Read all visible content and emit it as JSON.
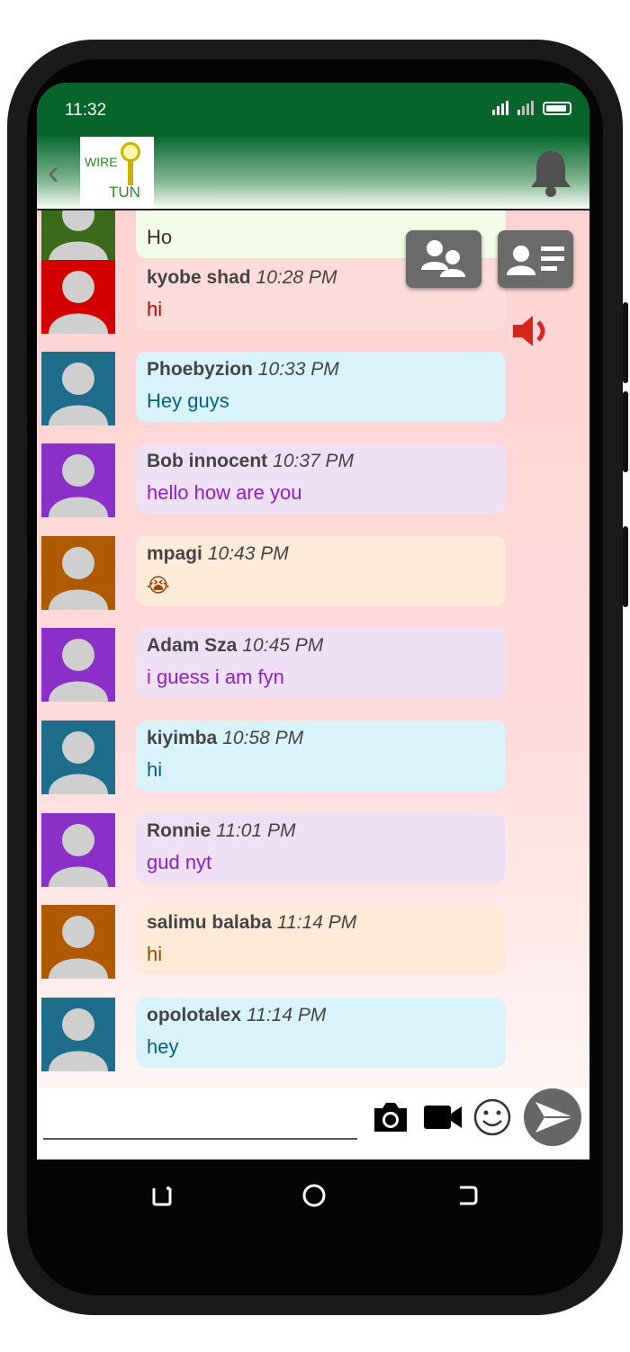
{
  "status": {
    "time": "11:32"
  },
  "header": {
    "logo_top": "WIRE",
    "logo_bottom": "TUN"
  },
  "messages": [
    {
      "name": "",
      "time": "",
      "text": "Ho",
      "color": "#f3fbe6",
      "text_color": "#333333",
      "avatar_bg": "#3a6a1a"
    },
    {
      "name": "kyobe shad",
      "time": "10:28 PM",
      "text": "hi",
      "color": "#ffdcdc",
      "text_color": "#c40000",
      "avatar_bg": "#d40000"
    },
    {
      "name": "Phoebyzion",
      "time": "10:33 PM",
      "text": "Hey guys",
      "color": "#d9f3fb",
      "text_color": "#075f87",
      "avatar_bg": "#1e6d8a"
    },
    {
      "name": "Bob innocent",
      "time": "10:37 PM",
      "text": "hello how are you",
      "color": "#efe0f6",
      "text_color": "#8e1fc2",
      "avatar_bg": "#8a2fc8"
    },
    {
      "name": "mpagi",
      "time": "10:43 PM",
      "text": "😭",
      "color": "#fdebd9",
      "text_color": "#a04400",
      "avatar_bg": "#b05a00"
    },
    {
      "name": "Adam Sza",
      "time": "10:45 PM",
      "text": "i guess i am fyn",
      "color": "#efe0f6",
      "text_color": "#8e1fc2",
      "avatar_bg": "#8a2fc8"
    },
    {
      "name": "kiyimba",
      "time": "10:58 PM",
      "text": "hi",
      "color": "#d9f3fb",
      "text_color": "#075f87",
      "avatar_bg": "#1e6d8a"
    },
    {
      "name": "Ronnie",
      "time": "11:01 PM",
      "text": "gud nyt",
      "color": "#efe0f6",
      "text_color": "#8e1fc2",
      "avatar_bg": "#8a2fc8"
    },
    {
      "name": "salimu balaba",
      "time": "11:14 PM",
      "text": "hi",
      "color": "#fdebd9",
      "text_color": "#a04400",
      "avatar_bg": "#b05a00"
    },
    {
      "name": "opolotalex",
      "time": "11:14 PM",
      "text": "hey",
      "color": "#d9f3fb",
      "text_color": "#075f87",
      "avatar_bg": "#1e6d8a"
    }
  ],
  "input": {
    "placeholder": ""
  }
}
